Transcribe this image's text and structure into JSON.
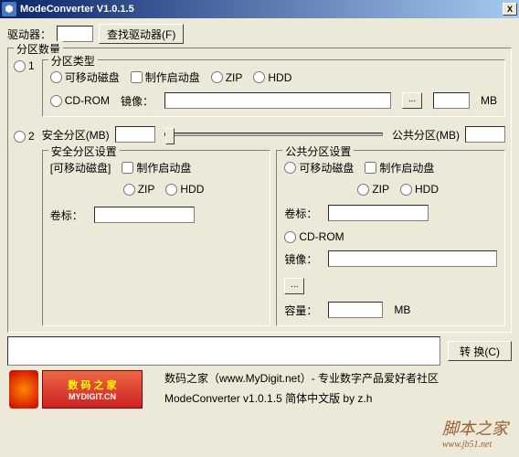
{
  "window": {
    "title": "ModeConverter V1.0.1.5",
    "close": "X"
  },
  "driver": {
    "label": "驱动器：",
    "value": "",
    "find_button": "查找驱动器(F)"
  },
  "partition_count_group": "分区数量",
  "option1": {
    "num": "1",
    "type_group": "分区类型",
    "removable": "可移动磁盘",
    "make_boot": "制作启动盘",
    "zip": "ZIP",
    "hdd": "HDD",
    "cdrom": "CD-ROM",
    "image_label": "镜像：",
    "image_value": "",
    "browse": "...",
    "mb": "MB"
  },
  "option2": {
    "num": "2",
    "safe_label": "安全分区(MB)",
    "safe_value": "",
    "public_label": "公共分区(MB)",
    "public_value": "",
    "safe_group": {
      "title": "安全分区设置",
      "removable_note": "[可移动磁盘]",
      "make_boot": "制作启动盘",
      "zip": "ZIP",
      "hdd": "HDD",
      "volume_label": "卷标：",
      "volume_value": ""
    },
    "public_group": {
      "title": "公共分区设置",
      "removable": "可移动磁盘",
      "make_boot": "制作启动盘",
      "zip": "ZIP",
      "hdd": "HDD",
      "volume_label": "卷标：",
      "volume_value": "",
      "cdrom": "CD-ROM",
      "image_label": "镜像：",
      "image_value": "",
      "capacity_label": "容量：",
      "capacity_value": "",
      "mb": "MB"
    }
  },
  "convert_button": "转 换(C)",
  "status_value": "",
  "logo": {
    "line1": "数 码 之 家",
    "line2": "MYDIGIT.CN"
  },
  "info": {
    "line1": "数码之家（www.MyDigit.net）- 专业数字产品爱好者社区",
    "line2": "ModeConverter v1.0.1.5 简体中文版 by z.h"
  },
  "watermark": {
    "main": "脚本之家",
    "sub": "www.jb51.net"
  }
}
